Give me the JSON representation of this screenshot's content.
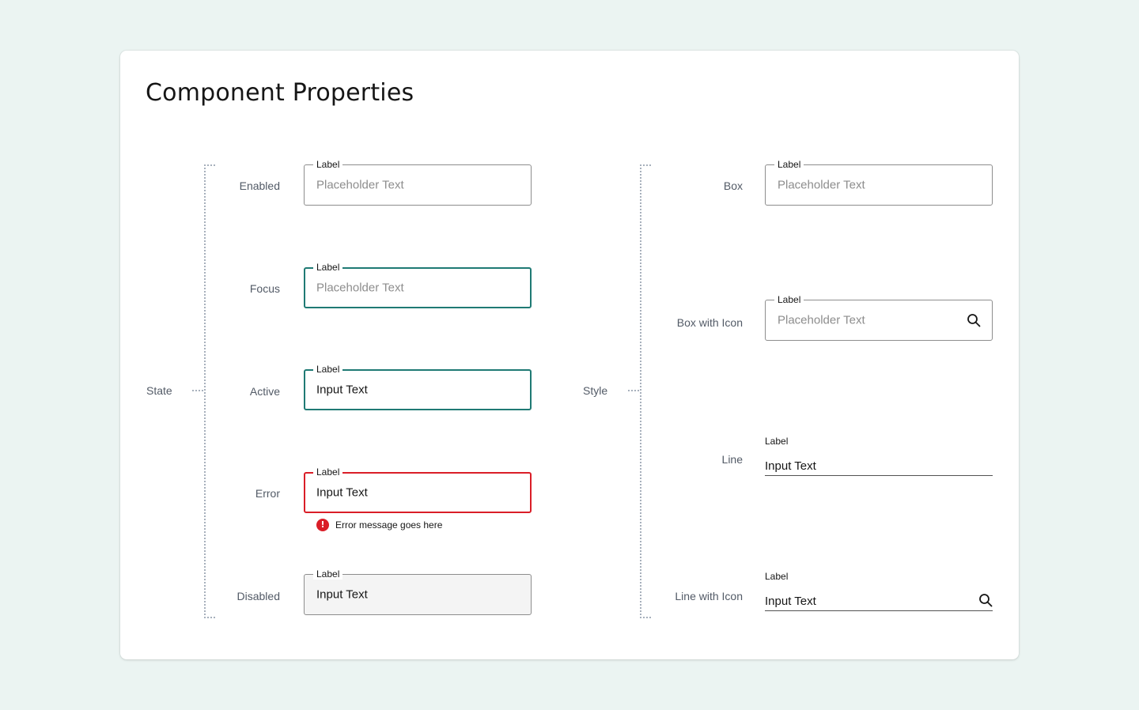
{
  "title": "Component Properties",
  "state": {
    "group_label": "State",
    "rows": [
      {
        "name": "Enabled",
        "label": "Label",
        "value": "Placeholder Text"
      },
      {
        "name": "Focus",
        "label": "Label",
        "value": "Placeholder Text"
      },
      {
        "name": "Active",
        "label": "Label",
        "value": "Input Text"
      },
      {
        "name": "Error",
        "label": "Label",
        "value": "Input Text",
        "error_message": "Error message goes here",
        "error_icon": "!"
      },
      {
        "name": "Disabled",
        "label": "Label",
        "value": "Input Text"
      }
    ]
  },
  "style": {
    "group_label": "Style",
    "rows": [
      {
        "name": "Box",
        "label": "Label",
        "value": "Placeholder Text"
      },
      {
        "name": "Box with Icon",
        "label": "Label",
        "value": "Placeholder Text",
        "icon": "search-icon"
      },
      {
        "name": "Line",
        "label": "Label",
        "value": "Input Text"
      },
      {
        "name": "Line with Icon",
        "label": "Label",
        "value": "Input Text",
        "icon": "search-icon"
      }
    ]
  },
  "colors": {
    "background": "#ebf4f2",
    "focus_border": "#1f7a74",
    "error": "#da1e28",
    "disabled_fill": "#f4f4f4",
    "placeholder": "#8d8d8d"
  }
}
